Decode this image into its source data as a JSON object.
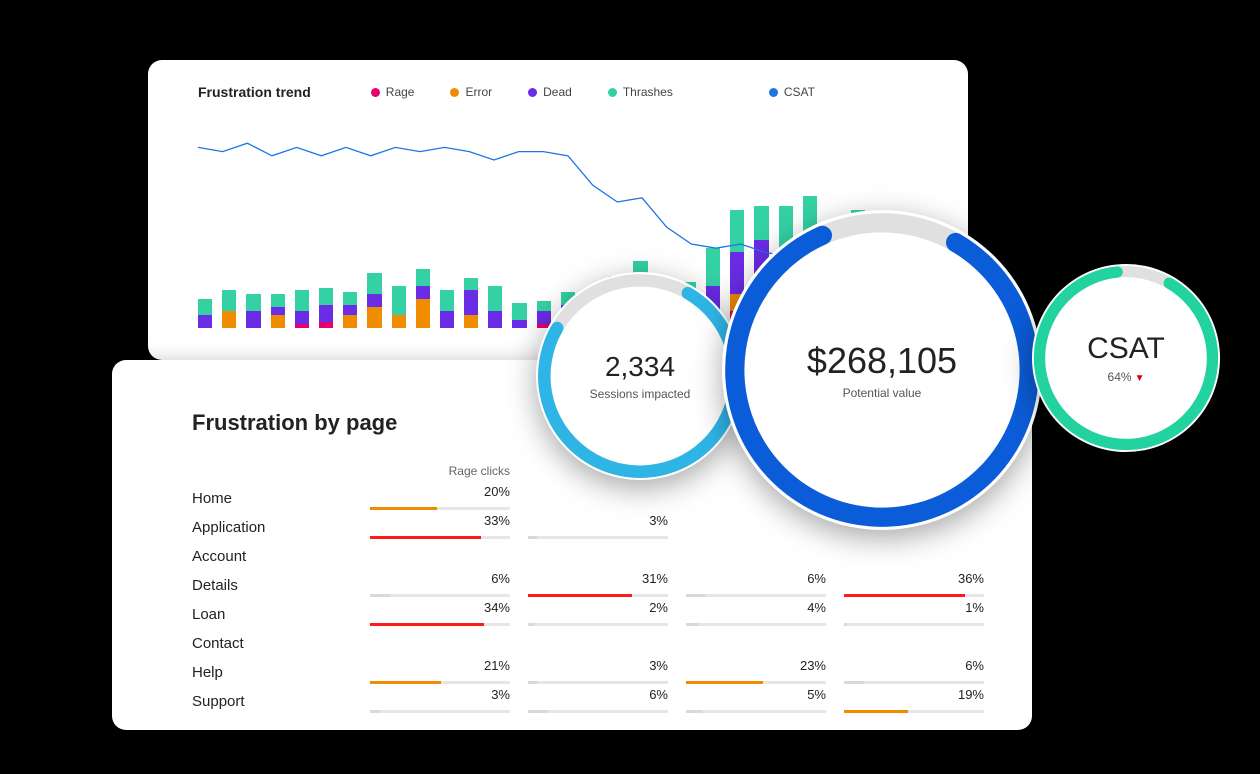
{
  "colors": {
    "rage": "#e5006d",
    "error": "#f08c00",
    "dead": "#6a2ce5",
    "thrashes": "#33d1a3",
    "csat": "#1e74e6",
    "red": "#ff1a1a",
    "orange": "#f08c00",
    "lightblue": "#2fb4e6",
    "blue": "#0b5cd8",
    "green": "#22d3a0",
    "grey": "#d9d9d9"
  },
  "trend": {
    "title": "Frustration trend",
    "legend": [
      {
        "label": "Rage",
        "colorKey": "rage"
      },
      {
        "label": "Error",
        "colorKey": "error"
      },
      {
        "label": "Dead",
        "colorKey": "dead"
      },
      {
        "label": "Thrashes",
        "colorKey": "thrashes"
      },
      {
        "label": "CSAT",
        "colorKey": "csat"
      }
    ]
  },
  "chart_data": {
    "type": "bar",
    "title": "Frustration trend",
    "xlabel": "",
    "ylabel": "",
    "ylim": [
      0,
      100
    ],
    "series": [
      {
        "name": "Rage",
        "values": [
          0,
          0,
          0,
          0,
          2,
          3,
          0,
          0,
          0,
          0,
          0,
          0,
          0,
          0,
          2,
          0,
          0,
          5,
          0,
          0,
          0,
          4,
          8,
          6,
          10,
          5,
          0,
          6,
          3,
          0,
          3
        ]
      },
      {
        "name": "Error",
        "values": [
          0,
          8,
          0,
          6,
          0,
          0,
          6,
          10,
          6,
          14,
          0,
          6,
          0,
          0,
          0,
          6,
          0,
          0,
          14,
          0,
          0,
          0,
          8,
          18,
          0,
          18,
          0,
          14,
          0,
          0,
          0
        ]
      },
      {
        "name": "Dead",
        "values": [
          6,
          0,
          8,
          4,
          6,
          8,
          5,
          6,
          0,
          6,
          8,
          12,
          8,
          4,
          6,
          5,
          6,
          10,
          6,
          10,
          8,
          16,
          20,
          18,
          22,
          18,
          20,
          16,
          10,
          12,
          8
        ]
      },
      {
        "name": "Thrashes",
        "values": [
          8,
          10,
          8,
          6,
          10,
          8,
          6,
          10,
          14,
          8,
          10,
          6,
          12,
          8,
          5,
          6,
          8,
          10,
          12,
          10,
          14,
          18,
          20,
          16,
          26,
          22,
          18,
          20,
          14,
          12,
          10
        ]
      }
    ],
    "line_series": {
      "name": "CSAT",
      "values": [
        86,
        84,
        88,
        82,
        86,
        82,
        86,
        82,
        86,
        84,
        86,
        84,
        80,
        84,
        84,
        82,
        68,
        60,
        62,
        48,
        40,
        38,
        40,
        36,
        34,
        32,
        28,
        30,
        24,
        28,
        26
      ]
    }
  },
  "table": {
    "title": "Frustration by page",
    "columns": [
      "Rage clicks",
      "",
      "",
      ""
    ],
    "pages": [
      "Home",
      "Application",
      "Account",
      "Details",
      "Loan",
      "Contact",
      "Help",
      "Support"
    ],
    "rows": [
      [
        {
          "v": 20,
          "c": "orange"
        },
        null,
        null,
        null
      ],
      [
        {
          "v": 33,
          "c": "red"
        },
        {
          "v": 3,
          "c": "grey"
        },
        null,
        null
      ],
      [
        null,
        null,
        null,
        null
      ],
      [
        {
          "v": 6,
          "c": "grey"
        },
        {
          "v": 31,
          "c": "red"
        },
        {
          "v": 6,
          "c": "grey"
        },
        {
          "v": 36,
          "c": "red"
        }
      ],
      [
        {
          "v": 34,
          "c": "red"
        },
        {
          "v": 2,
          "c": "grey"
        },
        {
          "v": 4,
          "c": "grey"
        },
        {
          "v": 1,
          "c": "grey"
        }
      ],
      [
        null,
        null,
        null,
        null
      ],
      [
        {
          "v": 21,
          "c": "orange"
        },
        {
          "v": 3,
          "c": "grey"
        },
        {
          "v": 23,
          "c": "orange"
        },
        {
          "v": 6,
          "c": "grey"
        }
      ],
      [
        {
          "v": 3,
          "c": "grey"
        },
        {
          "v": 6,
          "c": "grey"
        },
        {
          "v": 5,
          "c": "grey"
        },
        {
          "v": 19,
          "c": "orange"
        }
      ]
    ]
  },
  "circles": {
    "sessions": {
      "value": "2,334",
      "sub": "Sessions impacted",
      "pct": 75,
      "colorKey": "lightblue"
    },
    "potential": {
      "value": "$268,105",
      "sub": "Potential value",
      "pct": 85,
      "colorKey": "blue"
    },
    "csat": {
      "value": "CSAT",
      "sub": "64%",
      "pct": 90,
      "colorKey": "green",
      "trend": "down"
    }
  }
}
